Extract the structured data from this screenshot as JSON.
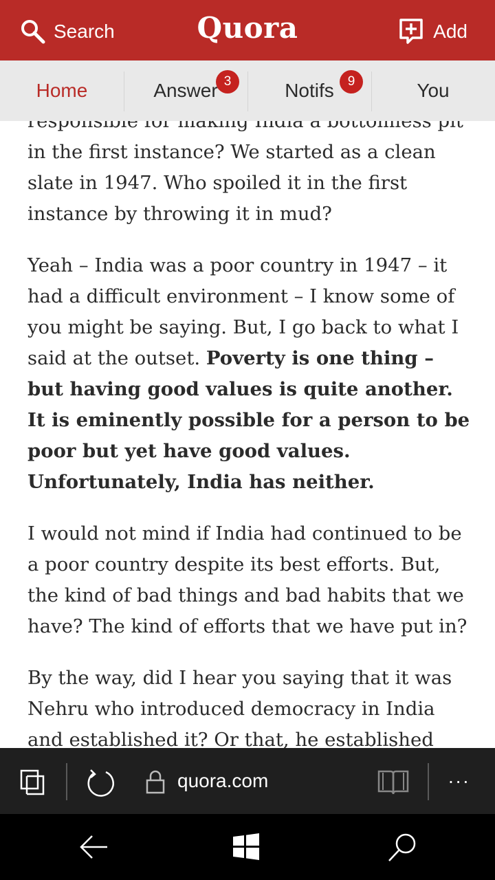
{
  "header": {
    "search_label": "Search",
    "logo": "Quora",
    "add_label": "Add",
    "bg_color": "#b92b27"
  },
  "tabs": [
    {
      "label": "Home",
      "active": true
    },
    {
      "label": "Answer",
      "badge": "3"
    },
    {
      "label": "Notifs",
      "badge": "9"
    },
    {
      "label": "You"
    }
  ],
  "article": {
    "paragraphs": [
      {
        "text": "responsible for making India a bottomless pit in the first instance? We started as a clean slate in 1947. Who spoiled it in the first instance by throwing it in mud?"
      },
      {
        "text": "Yeah – India was a poor country in 1947 – it had a difficult environment – I know some of you might be saying. But, I go back to what I said at the outset. ",
        "bold": "Poverty is one thing – but having good values is quite another. It is eminently possible for a person to be poor but yet have good values. Unfortunately, India has neither."
      },
      {
        "text": "I would not mind if India had continued to be a poor country despite its best efforts. But, the kind of bad things and bad habits that we have? The kind of efforts that we have put in?"
      },
      {
        "text": "By the way, did I hear you saying that it was Nehru who introduced democracy in India and established it? Or that, he established"
      }
    ]
  },
  "browser": {
    "url": "quora.com",
    "more_label": "..."
  },
  "icons": [
    "search-icon",
    "add-question-icon",
    "tabs-icon",
    "refresh-icon",
    "lock-icon",
    "reading-view-icon",
    "back-icon",
    "windows-start-icon",
    "cortana-search-icon"
  ]
}
